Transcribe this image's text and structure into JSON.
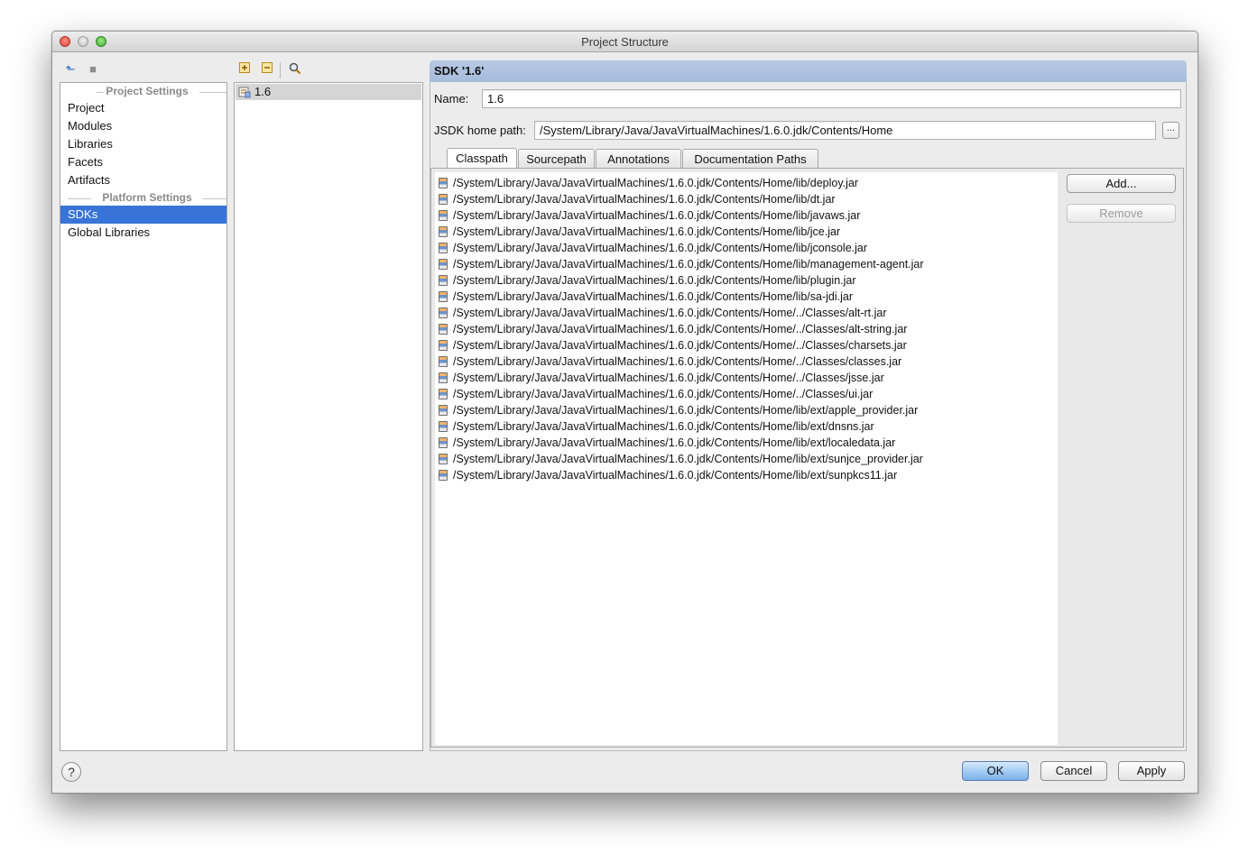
{
  "window": {
    "title": "Project Structure"
  },
  "left_toolbar": {
    "back_icon": "back-arrow-icon",
    "forward_icon": "forward-icon"
  },
  "sdk_toolbar": {
    "add_icon": "add-icon",
    "remove_icon": "remove-icon",
    "find_icon": "search-icon"
  },
  "sidebar": {
    "project_settings_header": "Project Settings",
    "platform_settings_header": "Platform Settings",
    "project_items": [
      "Project",
      "Modules",
      "Libraries",
      "Facets",
      "Artifacts"
    ],
    "platform_items": [
      "SDKs",
      "Global Libraries"
    ],
    "selected": "SDKs"
  },
  "sdk_list": {
    "items": [
      "1.6"
    ],
    "selected": "1.6"
  },
  "sdk_panel": {
    "header": "SDK '1.6'",
    "name_label": "Name:",
    "name_value": "1.6",
    "home_label": "JSDK home path:",
    "home_value": "/System/Library/Java/JavaVirtualMachines/1.6.0.jdk/Contents/Home",
    "browse_label": "...",
    "tabs": [
      "Classpath",
      "Sourcepath",
      "Annotations",
      "Documentation Paths"
    ],
    "active_tab": "Classpath",
    "classpath": [
      "/System/Library/Java/JavaVirtualMachines/1.6.0.jdk/Contents/Home/lib/deploy.jar",
      "/System/Library/Java/JavaVirtualMachines/1.6.0.jdk/Contents/Home/lib/dt.jar",
      "/System/Library/Java/JavaVirtualMachines/1.6.0.jdk/Contents/Home/lib/javaws.jar",
      "/System/Library/Java/JavaVirtualMachines/1.6.0.jdk/Contents/Home/lib/jce.jar",
      "/System/Library/Java/JavaVirtualMachines/1.6.0.jdk/Contents/Home/lib/jconsole.jar",
      "/System/Library/Java/JavaVirtualMachines/1.6.0.jdk/Contents/Home/lib/management-agent.jar",
      "/System/Library/Java/JavaVirtualMachines/1.6.0.jdk/Contents/Home/lib/plugin.jar",
      "/System/Library/Java/JavaVirtualMachines/1.6.0.jdk/Contents/Home/lib/sa-jdi.jar",
      "/System/Library/Java/JavaVirtualMachines/1.6.0.jdk/Contents/Home/../Classes/alt-rt.jar",
      "/System/Library/Java/JavaVirtualMachines/1.6.0.jdk/Contents/Home/../Classes/alt-string.jar",
      "/System/Library/Java/JavaVirtualMachines/1.6.0.jdk/Contents/Home/../Classes/charsets.jar",
      "/System/Library/Java/JavaVirtualMachines/1.6.0.jdk/Contents/Home/../Classes/classes.jar",
      "/System/Library/Java/JavaVirtualMachines/1.6.0.jdk/Contents/Home/../Classes/jsse.jar",
      "/System/Library/Java/JavaVirtualMachines/1.6.0.jdk/Contents/Home/../Classes/ui.jar",
      "/System/Library/Java/JavaVirtualMachines/1.6.0.jdk/Contents/Home/lib/ext/apple_provider.jar",
      "/System/Library/Java/JavaVirtualMachines/1.6.0.jdk/Contents/Home/lib/ext/dnsns.jar",
      "/System/Library/Java/JavaVirtualMachines/1.6.0.jdk/Contents/Home/lib/ext/localedata.jar",
      "/System/Library/Java/JavaVirtualMachines/1.6.0.jdk/Contents/Home/lib/ext/sunjce_provider.jar",
      "/System/Library/Java/JavaVirtualMachines/1.6.0.jdk/Contents/Home/lib/ext/sunpkcs11.jar"
    ],
    "add_button": "Add...",
    "remove_button": "Remove"
  },
  "footer": {
    "help": "?",
    "ok": "OK",
    "cancel": "Cancel",
    "apply": "Apply"
  },
  "colors": {
    "selection": "#3874d7",
    "header_bg": "#a6bbdc",
    "default_button": "#77b1ea"
  }
}
